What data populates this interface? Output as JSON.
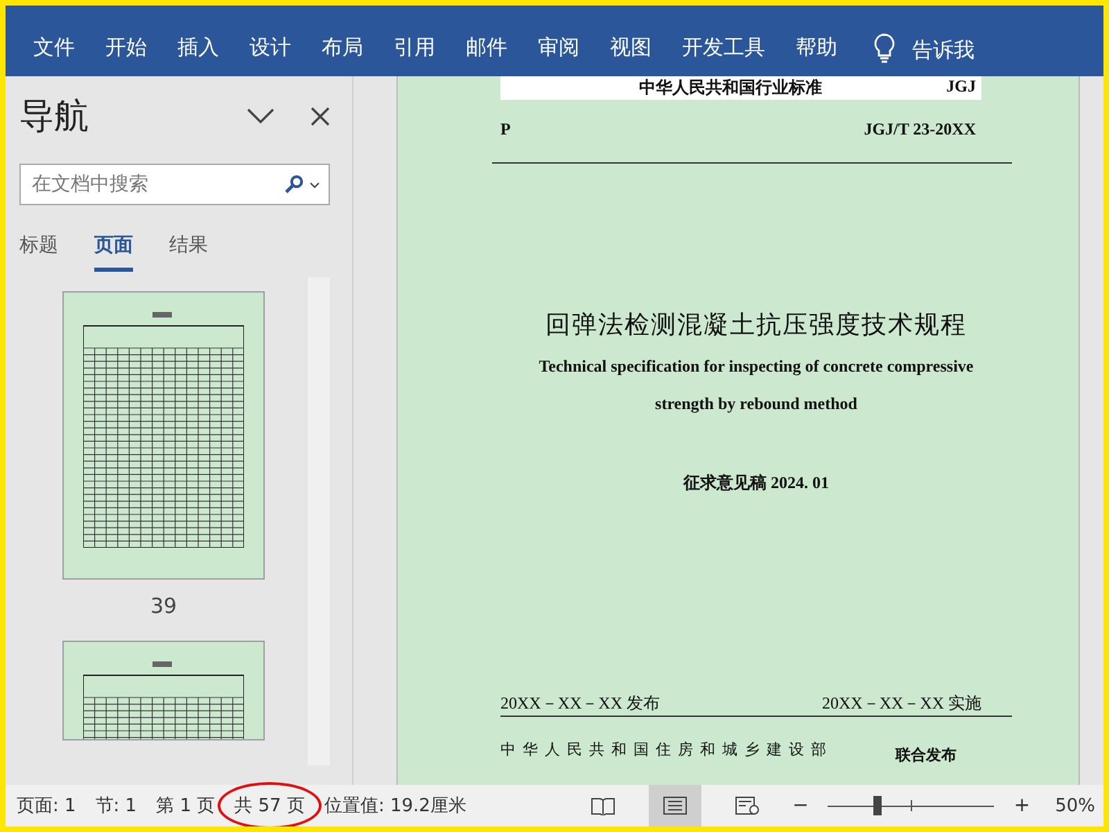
{
  "ribbon": {
    "tabs": [
      {
        "label": "文件",
        "selected": false
      },
      {
        "label": "开始",
        "selected": false
      },
      {
        "label": "插入",
        "selected": false
      },
      {
        "label": "设计",
        "selected": false
      },
      {
        "label": "布局",
        "selected": false
      },
      {
        "label": "引用",
        "selected": false
      },
      {
        "label": "邮件",
        "selected": false
      },
      {
        "label": "审阅",
        "selected": false
      },
      {
        "label": "视图",
        "selected": false
      },
      {
        "label": "开发工具",
        "selected": false
      },
      {
        "label": "帮助",
        "selected": false
      }
    ],
    "tell_me": "告诉我"
  },
  "nav": {
    "title": "导航",
    "search": {
      "placeholder": "在文档中搜索"
    },
    "tabs": [
      {
        "label": "标题",
        "selected": false
      },
      {
        "label": "页面",
        "selected": true
      },
      {
        "label": "结果",
        "selected": false
      }
    ],
    "thumbnails": [
      {
        "label": "39",
        "cut_off": false
      },
      {
        "cut_off": true
      }
    ]
  },
  "document": {
    "header_band": {
      "left": "中华人民共和国行业标准",
      "right": "JGJ"
    },
    "classification": "P",
    "standard_no": "JGJ/T 23-20XX",
    "title": "回弹法检测混凝土抗压强度技术规程",
    "subtitle_lines": [
      "Technical specification for inspecting of concrete compressive",
      "strength by rebound method"
    ],
    "draft": "征求意见稿 2024. 01",
    "issue_date": "20XX－XX－XX 发布",
    "effective_date": "20XX－XX－XX 实施",
    "issuer": "中华人民共和国住房和城乡建设部",
    "joint": "联合发布"
  },
  "status_bar": {
    "items": [
      {
        "text": "页面: 1",
        "circled": false
      },
      {
        "text": "节: 1",
        "circled": false
      },
      {
        "text": "第 1 页",
        "circled": false
      },
      {
        "text": "共 57 页",
        "circled": true
      },
      {
        "text": "位置值: 19.2厘米",
        "circled": false
      }
    ],
    "views": [
      {
        "kind": "read",
        "selected": false
      },
      {
        "kind": "print",
        "selected": true
      },
      {
        "kind": "web",
        "selected": false
      }
    ],
    "zoom": {
      "minus": "−",
      "plus": "+",
      "level": 0.3,
      "reading": "50%"
    }
  }
}
